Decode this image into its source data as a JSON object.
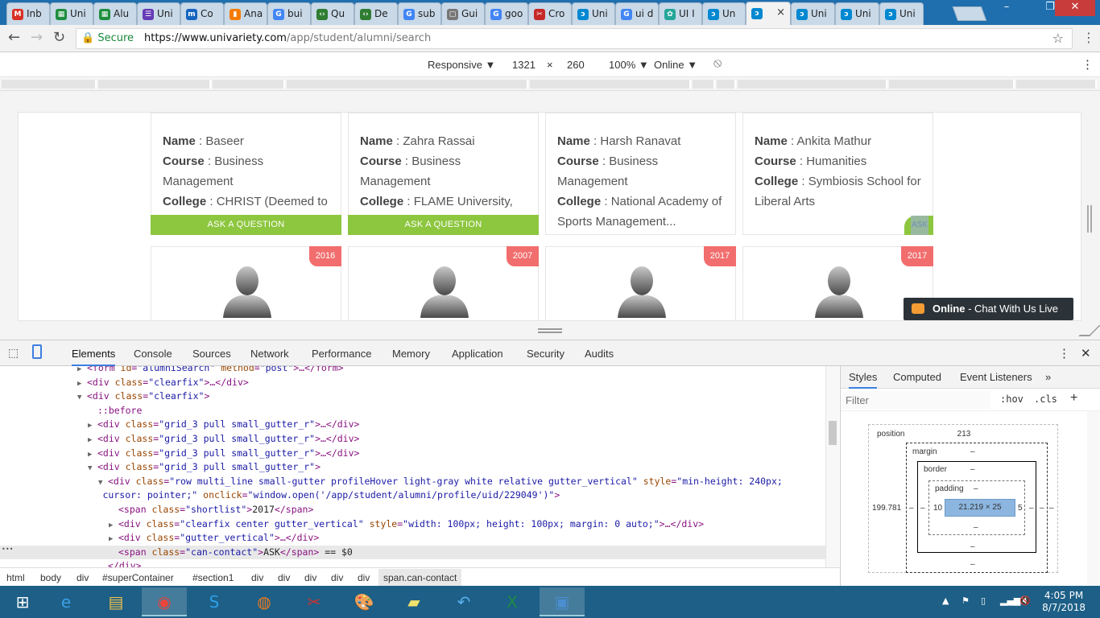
{
  "browser": {
    "tabs": [
      {
        "label": "Inb",
        "color": "#d93025",
        "glyph": "M"
      },
      {
        "label": "Uni",
        "color": "#1e8e3e",
        "glyph": "▦"
      },
      {
        "label": "Alu",
        "color": "#1e8e3e",
        "glyph": "▦"
      },
      {
        "label": "Uni",
        "color": "#673ab7",
        "glyph": "☰"
      },
      {
        "label": "Co",
        "color": "#1565c0",
        "glyph": "m"
      },
      {
        "label": "Ana",
        "color": "#f57c00",
        "glyph": "▮"
      },
      {
        "label": "bui",
        "color": "#4285f4",
        "glyph": "G"
      },
      {
        "label": "Qu",
        "color": "#2e7d32",
        "glyph": "‹›"
      },
      {
        "label": "De",
        "color": "#2e7d32",
        "glyph": "‹›"
      },
      {
        "label": "sub",
        "color": "#4285f4",
        "glyph": "G"
      },
      {
        "label": "Gui",
        "color": "#777777",
        "glyph": "▢"
      },
      {
        "label": "goo",
        "color": "#4285f4",
        "glyph": "G"
      },
      {
        "label": "Cro",
        "color": "#c62828",
        "glyph": "✂"
      },
      {
        "label": "Uni",
        "color": "#0288d1",
        "glyph": "ɔ"
      },
      {
        "label": "ui d",
        "color": "#4285f4",
        "glyph": "G"
      },
      {
        "label": "UI I",
        "color": "#26a69a",
        "glyph": "✿"
      },
      {
        "label": "Un",
        "color": "#0288d1",
        "glyph": "ɔ"
      },
      {
        "label": "",
        "color": "#0288d1",
        "glyph": "ɔ",
        "active": true
      },
      {
        "label": "Uni",
        "color": "#0288d1",
        "glyph": "ɔ"
      },
      {
        "label": "Uni",
        "color": "#0288d1",
        "glyph": "ɔ"
      },
      {
        "label": "Uni",
        "color": "#0288d1",
        "glyph": "ɔ"
      }
    ],
    "active_tab_close": "×",
    "window_buttons": {
      "minimize": "–",
      "maximize": "❐",
      "close": "✕"
    },
    "nav": {
      "back": "←",
      "forward": "→",
      "reload": "↻"
    },
    "secure_label": "Secure",
    "url_scheme_host": "https://www.univariety.com",
    "url_path": "/app/student/alumni/search",
    "star": "☆",
    "menu": "⋮"
  },
  "device_toolbar": {
    "mode": "Responsive ▼",
    "width": "1321",
    "times": "×",
    "height": "260",
    "zoom": "100% ▼",
    "network": "Online ▼",
    "rotate": "⦸",
    "menu": "⋮"
  },
  "cards": [
    {
      "name_label": "Name",
      "name": "Baseer",
      "course_label": "Course",
      "course": "Business Management",
      "college_label": "College",
      "college": "CHRIST (Deemed to be University)",
      "action": "ASK A QUESTION"
    },
    {
      "name_label": "Name",
      "name": "Zahra Rassai",
      "course_label": "Course",
      "course": "Business Management",
      "college_label": "College",
      "college": "FLAME University, Pune",
      "action": "ASK A QUESTION"
    },
    {
      "name_label": "Name",
      "name": "Harsh Ranavat",
      "course_label": "Course",
      "course": "Business Management",
      "college_label": "College",
      "college": "National Academy of Sports Management...",
      "action": ""
    },
    {
      "name_label": "Name",
      "name": "Ankita Mathur",
      "course_label": "Course",
      "course": "Humanities",
      "college_label": "College",
      "college": "Symbiosis School for Liberal Arts",
      "action": "ASK"
    }
  ],
  "profile_years": [
    "2016",
    "2007",
    "2017",
    "2017"
  ],
  "chat": {
    "status": "Online",
    "text": " - Chat With Us Live"
  },
  "devtools": {
    "tabs": [
      "Elements",
      "Console",
      "Sources",
      "Network",
      "Performance",
      "Memory",
      "Application",
      "Security",
      "Audits"
    ],
    "more": "⋮",
    "close": "✕",
    "code_lines": [
      {
        "indent": 0,
        "arrow": "▶",
        "parts": [
          [
            "tag",
            "<form "
          ],
          [
            "attr",
            "id"
          ],
          [
            "tag",
            "="
          ],
          [
            "val",
            "\"alumniSearch\""
          ],
          [
            "tag",
            " "
          ],
          [
            "attr",
            "method"
          ],
          [
            "tag",
            "="
          ],
          [
            "val",
            "\"post\""
          ],
          [
            "tag",
            ">…</form>"
          ]
        ]
      },
      {
        "indent": 0,
        "arrow": "▶",
        "parts": [
          [
            "tag",
            "<div "
          ],
          [
            "attr",
            "class"
          ],
          [
            "tag",
            "="
          ],
          [
            "val",
            "\"clearfix\""
          ],
          [
            "tag",
            ">…</div>"
          ]
        ]
      },
      {
        "indent": 0,
        "arrow": "▼",
        "parts": [
          [
            "tag",
            "<div "
          ],
          [
            "attr",
            "class"
          ],
          [
            "tag",
            "="
          ],
          [
            "val",
            "\"clearfix\""
          ],
          [
            "tag",
            ">"
          ]
        ]
      },
      {
        "indent": 1,
        "arrow": "",
        "parts": [
          [
            "pseudo",
            "::before"
          ]
        ]
      },
      {
        "indent": 1,
        "arrow": "▶",
        "parts": [
          [
            "tag",
            "<div "
          ],
          [
            "attr",
            "class"
          ],
          [
            "tag",
            "="
          ],
          [
            "val",
            "\"grid_3 pull small_gutter_r\""
          ],
          [
            "tag",
            ">…</div>"
          ]
        ]
      },
      {
        "indent": 1,
        "arrow": "▶",
        "parts": [
          [
            "tag",
            "<div "
          ],
          [
            "attr",
            "class"
          ],
          [
            "tag",
            "="
          ],
          [
            "val",
            "\"grid_3 pull small_gutter_r\""
          ],
          [
            "tag",
            ">…</div>"
          ]
        ]
      },
      {
        "indent": 1,
        "arrow": "▶",
        "parts": [
          [
            "tag",
            "<div "
          ],
          [
            "attr",
            "class"
          ],
          [
            "tag",
            "="
          ],
          [
            "val",
            "\"grid_3 pull small_gutter_r\""
          ],
          [
            "tag",
            ">…</div>"
          ]
        ]
      },
      {
        "indent": 1,
        "arrow": "▼",
        "parts": [
          [
            "tag",
            "<div "
          ],
          [
            "attr",
            "class"
          ],
          [
            "tag",
            "="
          ],
          [
            "val",
            "\"grid_3 pull small_gutter_r\""
          ],
          [
            "tag",
            ">"
          ]
        ]
      },
      {
        "indent": 2,
        "arrow": "▼",
        "parts": [
          [
            "tag",
            "<div "
          ],
          [
            "attr",
            "class"
          ],
          [
            "tag",
            "="
          ],
          [
            "val",
            "\"row multi_line small-gutter profileHover light-gray white relative gutter_vertical\""
          ],
          [
            "tag",
            " "
          ],
          [
            "attr",
            "style"
          ],
          [
            "tag",
            "="
          ],
          [
            "val",
            "\"min-height: 240px;"
          ]
        ]
      },
      {
        "indent": 1.5,
        "arrow": "",
        "parts": [
          [
            "val",
            "cursor: pointer;\""
          ],
          [
            "tag",
            " "
          ],
          [
            "attr",
            "onclick"
          ],
          [
            "tag",
            "="
          ],
          [
            "val",
            "\"window.open('/app/student/alumni/profile/uid/229049')\""
          ],
          [
            "tag",
            ">"
          ]
        ]
      },
      {
        "indent": 3,
        "arrow": "",
        "parts": [
          [
            "tag",
            "<span "
          ],
          [
            "attr",
            "class"
          ],
          [
            "tag",
            "="
          ],
          [
            "val",
            "\"shortlist\""
          ],
          [
            "tag",
            ">"
          ],
          [
            "txt",
            "2017"
          ],
          [
            "tag",
            "</span>"
          ]
        ]
      },
      {
        "indent": 3,
        "arrow": "▶",
        "parts": [
          [
            "tag",
            "<div "
          ],
          [
            "attr",
            "class"
          ],
          [
            "tag",
            "="
          ],
          [
            "val",
            "\"clearfix center gutter_vertical\""
          ],
          [
            "tag",
            " "
          ],
          [
            "attr",
            "style"
          ],
          [
            "tag",
            "="
          ],
          [
            "val",
            "\"width: 100px; height: 100px; margin: 0 auto;\""
          ],
          [
            "tag",
            ">…</div>"
          ]
        ]
      },
      {
        "indent": 3,
        "arrow": "▶",
        "parts": [
          [
            "tag",
            "<div "
          ],
          [
            "attr",
            "class"
          ],
          [
            "tag",
            "="
          ],
          [
            "val",
            "\"gutter_vertical\""
          ],
          [
            "tag",
            ">…</div>"
          ]
        ]
      },
      {
        "indent": 3,
        "arrow": "",
        "sel": true,
        "parts": [
          [
            "tag",
            "<span "
          ],
          [
            "attr",
            "class"
          ],
          [
            "tag",
            "="
          ],
          [
            "val",
            "\"can-contact\""
          ],
          [
            "tag",
            ">"
          ],
          [
            "txt",
            "ASK"
          ],
          [
            "tag",
            "</span>"
          ],
          [
            "txt",
            " == $0"
          ]
        ]
      },
      {
        "indent": 2,
        "arrow": "",
        "parts": [
          [
            "tag",
            "</div>"
          ]
        ]
      }
    ],
    "breadcrumbs": [
      "html",
      "body",
      "div",
      "#superContainer",
      "#section1",
      "div",
      "div",
      "div",
      "div",
      "div",
      "span.can-contact"
    ],
    "side_tabs": [
      "Styles",
      "Computed",
      "Event Listeners",
      "»"
    ],
    "filter_placeholder": "Filter",
    "filter_hov": ":hov",
    "filter_cls": ".cls",
    "filter_add": "+",
    "box_model": {
      "position_label": "position",
      "position_top": "213",
      "position_left": "199.781",
      "position_right": "–",
      "position_bottom": "0",
      "margin_label": "margin",
      "margin_top": "–",
      "margin_left": "–",
      "margin_right": "–",
      "margin_bottom": "–",
      "border_label": "border",
      "border_top": "–",
      "border_left": "–",
      "border_right": "–",
      "border_bottom": "–",
      "padding_label": "padding",
      "padding_top": "–",
      "padding_left": "10",
      "padding_right": "5",
      "padding_bottom": "–",
      "content_size": "21.219 × 25"
    }
  },
  "taskbar": {
    "apps": [
      {
        "name": "start",
        "glyph": "⊞"
      },
      {
        "name": "internet-explorer",
        "glyph": "e"
      },
      {
        "name": "file-explorer",
        "glyph": "▤"
      },
      {
        "name": "chrome",
        "glyph": "◉",
        "running": true
      },
      {
        "name": "skype",
        "glyph": "S"
      },
      {
        "name": "firefox",
        "glyph": "◍"
      },
      {
        "name": "snipping-tool",
        "glyph": "✂"
      },
      {
        "name": "paint",
        "glyph": "🎨"
      },
      {
        "name": "sticky-notes",
        "glyph": "▰"
      },
      {
        "name": "remote-arrow",
        "glyph": "↶"
      },
      {
        "name": "excel",
        "glyph": "X"
      },
      {
        "name": "photo-viewer",
        "glyph": "▣",
        "running": true
      }
    ],
    "tray_icons": [
      "▲",
      "⚑",
      "▯",
      "▂▄▆",
      "🔇"
    ],
    "time": "4:05 PM",
    "date": "8/7/2018"
  }
}
